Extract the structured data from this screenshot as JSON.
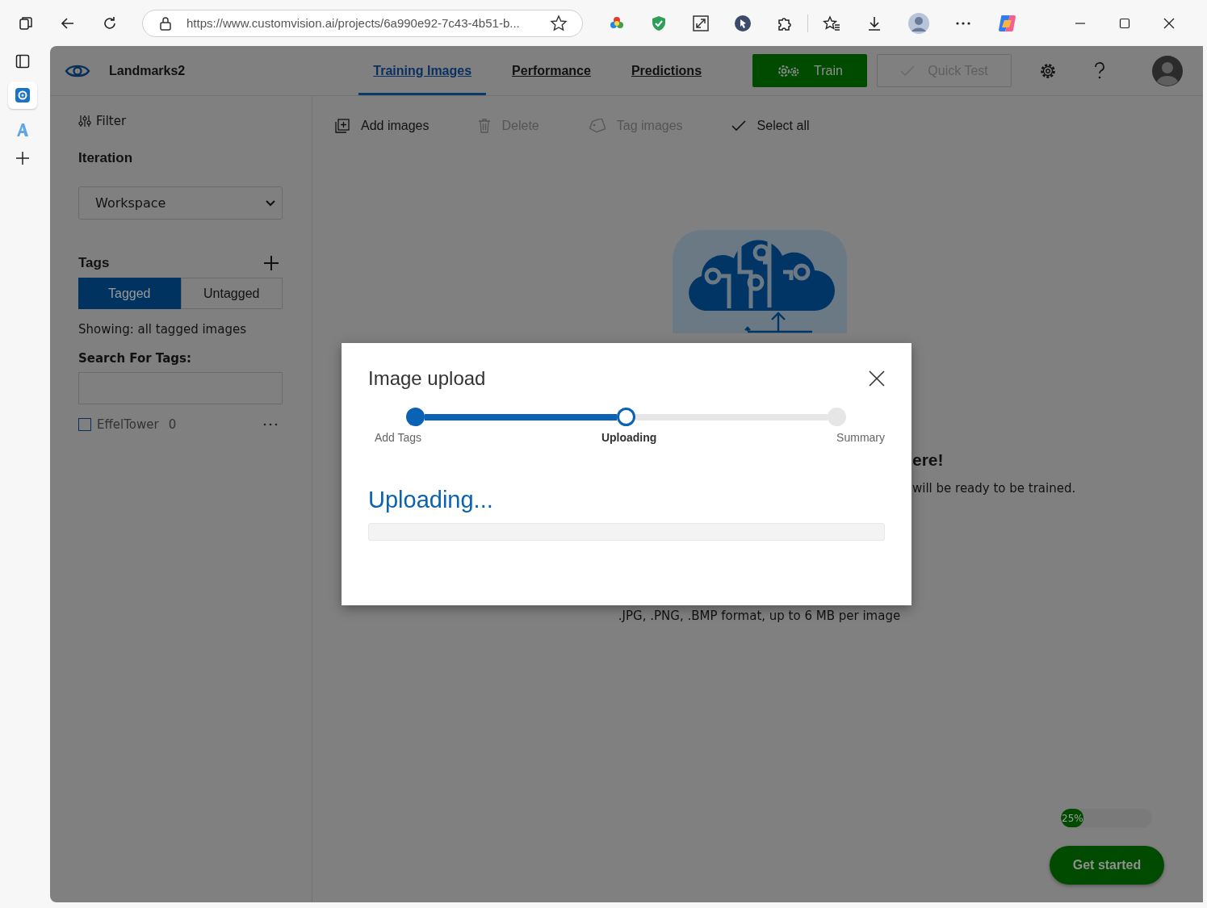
{
  "browser": {
    "url": "https://www.customvision.ai/projects/6a990e92-7c43-4b51-b..."
  },
  "header": {
    "project_name": "Landmarks2",
    "tabs": [
      {
        "label": "Training Images",
        "selected": true
      },
      {
        "label": "Performance",
        "selected": false
      },
      {
        "label": "Predictions",
        "selected": false
      }
    ],
    "buttons": [
      {
        "label": "Train",
        "kind": "primary",
        "disabled": false
      },
      {
        "label": "Quick Test",
        "kind": "test",
        "disabled": true
      }
    ]
  },
  "sidebar": {
    "filter": "Filter",
    "iteration_title": "Iteration",
    "iteration_value": "Workspace",
    "tags_title": "Tags",
    "tag_filters": [
      {
        "label": "Tagged",
        "selected": true
      },
      {
        "label": "Untagged",
        "selected": false
      }
    ],
    "showing": "Showing: all tagged images",
    "search_label": "Search For Tags:",
    "tags": [
      {
        "name": "EffelTower",
        "count": "0",
        "checked": false
      }
    ]
  },
  "toolbar": [
    {
      "label": "Add images",
      "kind": "add",
      "disabled": false
    },
    {
      "label": "Delete",
      "kind": "delete",
      "disabled": true
    },
    {
      "label": "Tag images",
      "kind": "tag",
      "disabled": true
    },
    {
      "label": "Select all",
      "kind": "select",
      "disabled": false
    }
  ],
  "empty_state": {
    "heading": "ere!",
    "text": "will be ready to be trained.",
    "formats": ".JPG, .PNG, .BMP format, up to 6 MB per image"
  },
  "progress": {
    "label": "25%",
    "level": 0.25
  },
  "get_started": "Get started",
  "dialog": {
    "title": "Image upload",
    "steps": [
      {
        "label": "Add Tags",
        "kind": "done"
      },
      {
        "label": "Uploading",
        "kind": "current"
      },
      {
        "label": "Summary",
        "kind": "pending"
      }
    ],
    "heading": "Uploading...",
    "upload": {
      "level": 0
    }
  }
}
